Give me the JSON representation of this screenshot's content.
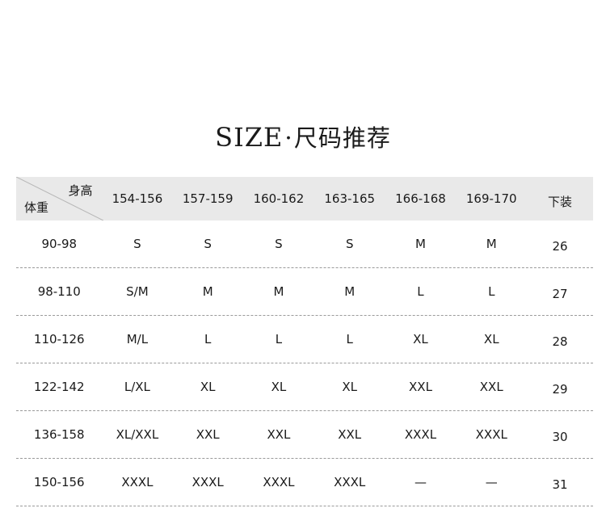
{
  "title": {
    "en": "SIZE",
    "sep": "·",
    "cn": "尺码推荐"
  },
  "table": {
    "corner": {
      "top_label": "身高",
      "bottom_label": "体重"
    },
    "columns": [
      "154-156",
      "157-159",
      "160-162",
      "163-165",
      "166-168",
      "169-170",
      "下装"
    ],
    "rows": [
      {
        "weight": "90-98",
        "cells": [
          "S",
          "S",
          "S",
          "S",
          "M",
          "M",
          "26"
        ]
      },
      {
        "weight": "98-110",
        "cells": [
          "S/M",
          "M",
          "M",
          "M",
          "L",
          "L",
          "27"
        ]
      },
      {
        "weight": "110-126",
        "cells": [
          "M/L",
          "L",
          "L",
          "L",
          "XL",
          "XL",
          "28"
        ]
      },
      {
        "weight": "122-142",
        "cells": [
          "L/XL",
          "XL",
          "XL",
          "XL",
          "XXL",
          "XXL",
          "29"
        ]
      },
      {
        "weight": "136-158",
        "cells": [
          "XL/XXL",
          "XXL",
          "XXL",
          "XXL",
          "XXXL",
          "XXXL",
          "30"
        ]
      },
      {
        "weight": "150-156",
        "cells": [
          "XXXL",
          "XXXL",
          "XXXL",
          "XXXL",
          "—",
          "—",
          "31"
        ]
      }
    ]
  }
}
